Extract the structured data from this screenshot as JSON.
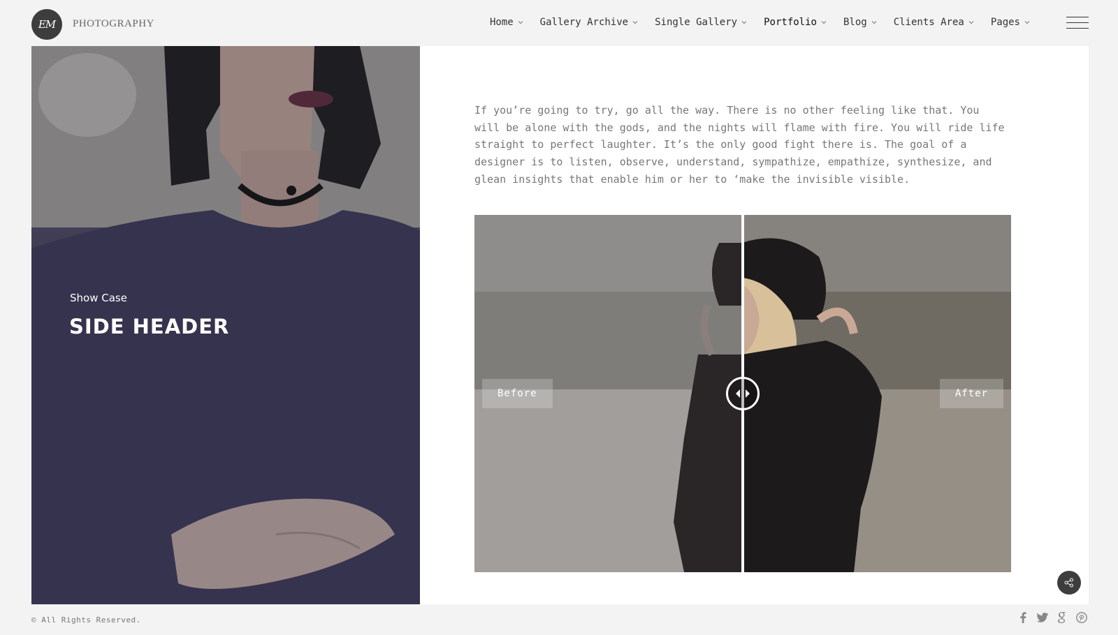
{
  "header": {
    "logo_mark": "EM",
    "logo_text": "PHOTOGRAPHY",
    "nav": [
      {
        "label": "Home"
      },
      {
        "label": "Gallery Archive"
      },
      {
        "label": "Single Gallery"
      },
      {
        "label": "Portfolio"
      },
      {
        "label": "Blog"
      },
      {
        "label": "Clients Area"
      },
      {
        "label": "Pages"
      }
    ],
    "active_nav": "Portfolio",
    "menu_icon": "hamburger-icon"
  },
  "side": {
    "subtitle": "Show Case",
    "title": "SIDE HEADER"
  },
  "content": {
    "paragraph": "If you’re going to try, go all the way. There is no other feeling like that. You will be alone with the gods, and the nights will flame with fire. You will ride life straight to perfect laughter. It’s the only good fight there is. The goal of a designer is to listen, observe, understand, sympathize, empathize, synthesize, and glean insights that enable him or her to ‘make the invisible visible."
  },
  "comparison": {
    "before_label": "Before",
    "after_label": "After",
    "split": 0.5
  },
  "footer": {
    "copyright": "© All Rights Reserved.",
    "social": [
      "facebook-icon",
      "twitter-icon",
      "google-plus-icon",
      "pinterest-icon"
    ]
  },
  "colors": {
    "page_bg": "#f3f3f3",
    "panel_bg": "#ffffff",
    "dark": "#3d3d3d",
    "text_gray": "#777777"
  }
}
